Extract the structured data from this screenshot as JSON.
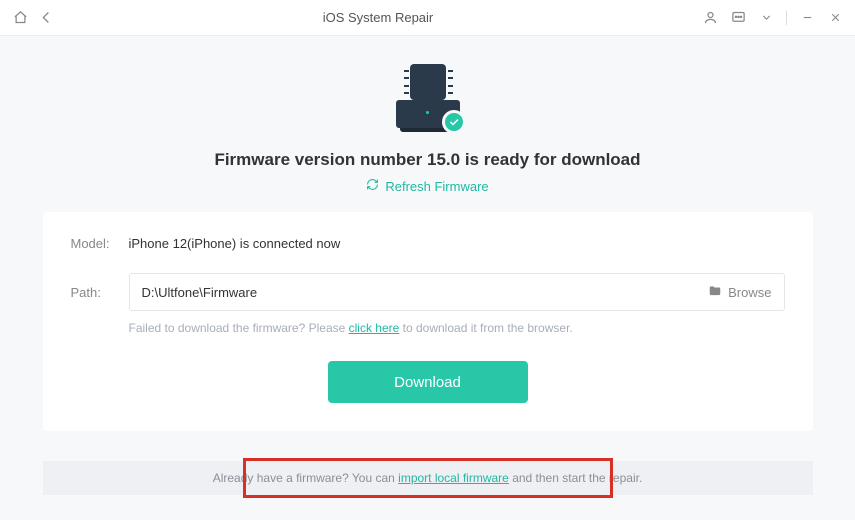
{
  "titlebar": {
    "title": "iOS System Repair"
  },
  "headline": "Firmware version number 15.0 is ready for download",
  "refresh_label": "Refresh Firmware",
  "model": {
    "label": "Model:",
    "value": "iPhone 12(iPhone) is connected now"
  },
  "path": {
    "label": "Path:",
    "value": "D:\\Ultfone\\Firmware",
    "browse_label": "Browse"
  },
  "helper": {
    "pre": "Failed to download the firmware? Please ",
    "link": "click here",
    "post": " to download it from the browser."
  },
  "download_label": "Download",
  "footer": {
    "pre": "Already have a firmware? You can ",
    "link": "import local firmware",
    "post": " and then start the repair."
  }
}
